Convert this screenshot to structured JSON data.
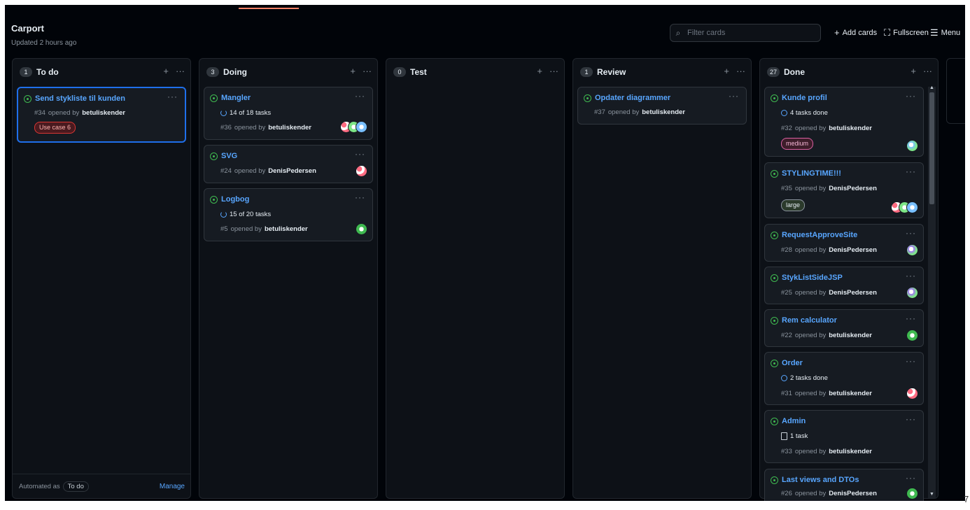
{
  "project": {
    "title": "Carport",
    "updated": "Updated 2 hours ago"
  },
  "header": {
    "filter_placeholder": "Filter cards",
    "add_cards": "Add cards",
    "fullscreen": "Fullscreen",
    "menu": "Menu"
  },
  "colors": {
    "background": "#010409",
    "column": "#0d1117",
    "card": "#161b22",
    "link": "#58a6ff",
    "open_issue": "#3fb950",
    "selected_border": "#1f6feb"
  },
  "columns": [
    {
      "name": "To do",
      "count": "1",
      "footer": {
        "automated": "Automated as",
        "automated_value": "To do",
        "manage": "Manage"
      },
      "cards": [
        {
          "title": "Send stykliste til kunden",
          "number": "#34",
          "opened_by": "opened by",
          "author": "betuliskender",
          "label": "Use case 6"
        }
      ]
    },
    {
      "name": "Doing",
      "count": "3",
      "cards": [
        {
          "title": "Mangler",
          "tasks": "14 of 18 tasks",
          "number": "#36",
          "opened_by": "opened by",
          "author": "betuliskender"
        },
        {
          "title": "SVG",
          "number": "#24",
          "opened_by": "opened by",
          "author": "DenisPedersen"
        },
        {
          "title": "Logbog",
          "tasks": "15 of 20 tasks",
          "number": "#5",
          "opened_by": "opened by",
          "author": "betuliskender"
        }
      ]
    },
    {
      "name": "Test",
      "count": "0",
      "cards": []
    },
    {
      "name": "Review",
      "count": "1",
      "cards": [
        {
          "title": "Opdater diagrammer",
          "number": "#37",
          "opened_by": "opened by",
          "author": "betuliskender"
        }
      ]
    },
    {
      "name": "Done",
      "count": "27",
      "cards": [
        {
          "title": "Kunde profil",
          "tasks": "4 tasks done",
          "number": "#32",
          "opened_by": "opened by",
          "author": "betuliskender",
          "label": "medium"
        },
        {
          "title": "STYLINGTIME!!!",
          "number": "#35",
          "opened_by": "opened by",
          "author": "DenisPedersen",
          "label": "large"
        },
        {
          "title": "RequestApproveSite",
          "number": "#28",
          "opened_by": "opened by",
          "author": "DenisPedersen"
        },
        {
          "title": "StykListSideJSP",
          "number": "#25",
          "opened_by": "opened by",
          "author": "DenisPedersen"
        },
        {
          "title": "Rem calculator",
          "number": "#22",
          "opened_by": "opened by",
          "author": "betuliskender"
        },
        {
          "title": "Order",
          "tasks": "2 tasks done",
          "number": "#31",
          "opened_by": "opened by",
          "author": "betuliskender"
        },
        {
          "title": "Admin",
          "tasks": "1 task",
          "number": "#33",
          "opened_by": "opened by",
          "author": "betuliskender"
        },
        {
          "title": "Last views and DTOs",
          "number": "#26",
          "opened_by": "opened by",
          "author": "DenisPedersen"
        }
      ]
    }
  ],
  "page_number": "7"
}
